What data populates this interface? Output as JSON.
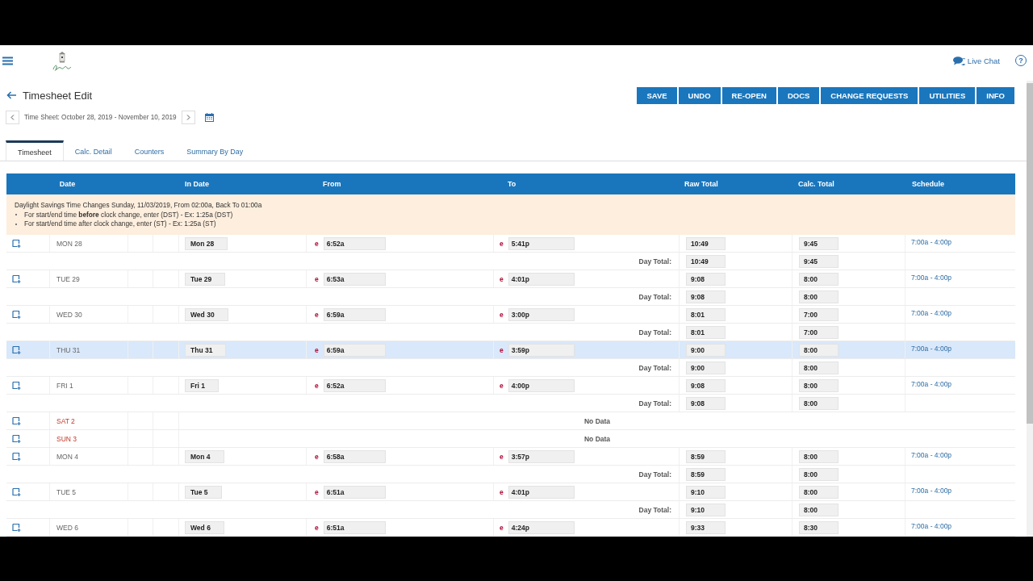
{
  "app_header": {
    "live_chat": "Live Chat",
    "help": "?"
  },
  "page": {
    "title": "Timesheet Edit",
    "period": "Time Sheet: October 28, 2019 - November 10, 2019"
  },
  "actions": [
    "SAVE",
    "UNDO",
    "RE-OPEN",
    "DOCS",
    "CHANGE REQUESTS",
    "UTILITIES",
    "INFO"
  ],
  "tabs": [
    {
      "label": "Timesheet",
      "selected": true
    },
    {
      "label": "Calc. Detail",
      "selected": false
    },
    {
      "label": "Counters",
      "selected": false
    },
    {
      "label": "Summary By Day",
      "selected": false
    }
  ],
  "table": {
    "columns": [
      "Date",
      "In Date",
      "From",
      "To",
      "Raw Total",
      "Calc. Total",
      "Schedule"
    ],
    "notice": {
      "title": "Daylight Savings Time Changes Sunday, 11/03/2019, From 02:00a, Back To 01:00a",
      "bullets": [
        "For start/end time **before** clock change, enter (DST) - Ex: 1:25a (DST)",
        "For start/end time after clock change, enter (ST) - Ex: 1:25a (ST)"
      ]
    },
    "rows": [
      {
        "kind": "entry",
        "day": "MON 28",
        "weekend": false,
        "selected": false,
        "in_date": "Mon 28",
        "from_flag": "e",
        "from": "6:52a",
        "to_flag": "e",
        "to": "5:41p",
        "raw_total": "10:49",
        "calc_total": "9:45",
        "schedule": "7:00a - 4:00p",
        "day_total": {
          "label": "Day Total:",
          "raw": "10:49",
          "calc": "9:45"
        }
      },
      {
        "kind": "entry",
        "day": "TUE 29",
        "weekend": false,
        "selected": false,
        "in_date": "Tue 29",
        "from_flag": "e",
        "from": "6:53a",
        "to_flag": "e",
        "to": "4:01p",
        "raw_total": "9:08",
        "calc_total": "8:00",
        "schedule": "7:00a - 4:00p",
        "day_total": {
          "label": "Day Total:",
          "raw": "9:08",
          "calc": "8:00"
        }
      },
      {
        "kind": "entry",
        "day": "WED 30",
        "weekend": false,
        "selected": false,
        "in_date": "Wed 30",
        "from_flag": "e",
        "from": "6:59a",
        "to_flag": "e",
        "to": "3:00p",
        "raw_total": "8:01",
        "calc_total": "7:00",
        "schedule": "7:00a - 4:00p",
        "day_total": {
          "label": "Day Total:",
          "raw": "8:01",
          "calc": "7:00"
        }
      },
      {
        "kind": "entry",
        "day": "THU 31",
        "weekend": false,
        "selected": true,
        "in_date": "Thu 31",
        "from_flag": "e",
        "from": "6:59a",
        "to_flag": "e",
        "to": "3:59p",
        "raw_total": "9:00",
        "calc_total": "8:00",
        "schedule": "7:00a - 4:00p",
        "day_total": {
          "label": "Day Total:",
          "raw": "9:00",
          "calc": "8:00"
        }
      },
      {
        "kind": "entry",
        "day": "FRI 1",
        "weekend": false,
        "selected": false,
        "in_date": "Fri 1",
        "from_flag": "e",
        "from": "6:52a",
        "to_flag": "e",
        "to": "4:00p",
        "raw_total": "9:08",
        "calc_total": "8:00",
        "schedule": "7:00a - 4:00p",
        "day_total": {
          "label": "Day Total:",
          "raw": "9:08",
          "calc": "8:00"
        }
      },
      {
        "kind": "no_data",
        "day": "SAT 2",
        "weekend": true,
        "selected": false,
        "message": "No Data"
      },
      {
        "kind": "no_data",
        "day": "SUN 3",
        "weekend": true,
        "selected": false,
        "message": "No Data"
      },
      {
        "kind": "entry",
        "day": "MON 4",
        "weekend": false,
        "selected": false,
        "in_date": "Mon 4",
        "from_flag": "e",
        "from": "6:58a",
        "to_flag": "e",
        "to": "3:57p",
        "raw_total": "8:59",
        "calc_total": "8:00",
        "schedule": "7:00a - 4:00p",
        "day_total": {
          "label": "Day Total:",
          "raw": "8:59",
          "calc": "8:00"
        }
      },
      {
        "kind": "entry",
        "day": "TUE 5",
        "weekend": false,
        "selected": false,
        "in_date": "Tue 5",
        "from_flag": "e",
        "from": "6:51a",
        "to_flag": "e",
        "to": "4:01p",
        "raw_total": "9:10",
        "calc_total": "8:00",
        "schedule": "7:00a - 4:00p",
        "day_total": {
          "label": "Day Total:",
          "raw": "9:10",
          "calc": "8:00"
        }
      },
      {
        "kind": "entry",
        "day": "WED 6",
        "weekend": false,
        "selected": false,
        "in_date": "Wed 6",
        "from_flag": "e",
        "from": "6:51a",
        "to_flag": "e",
        "to": "4:24p",
        "raw_total": "9:33",
        "calc_total": "8:30",
        "schedule": "7:00a - 4:00p"
      }
    ]
  }
}
